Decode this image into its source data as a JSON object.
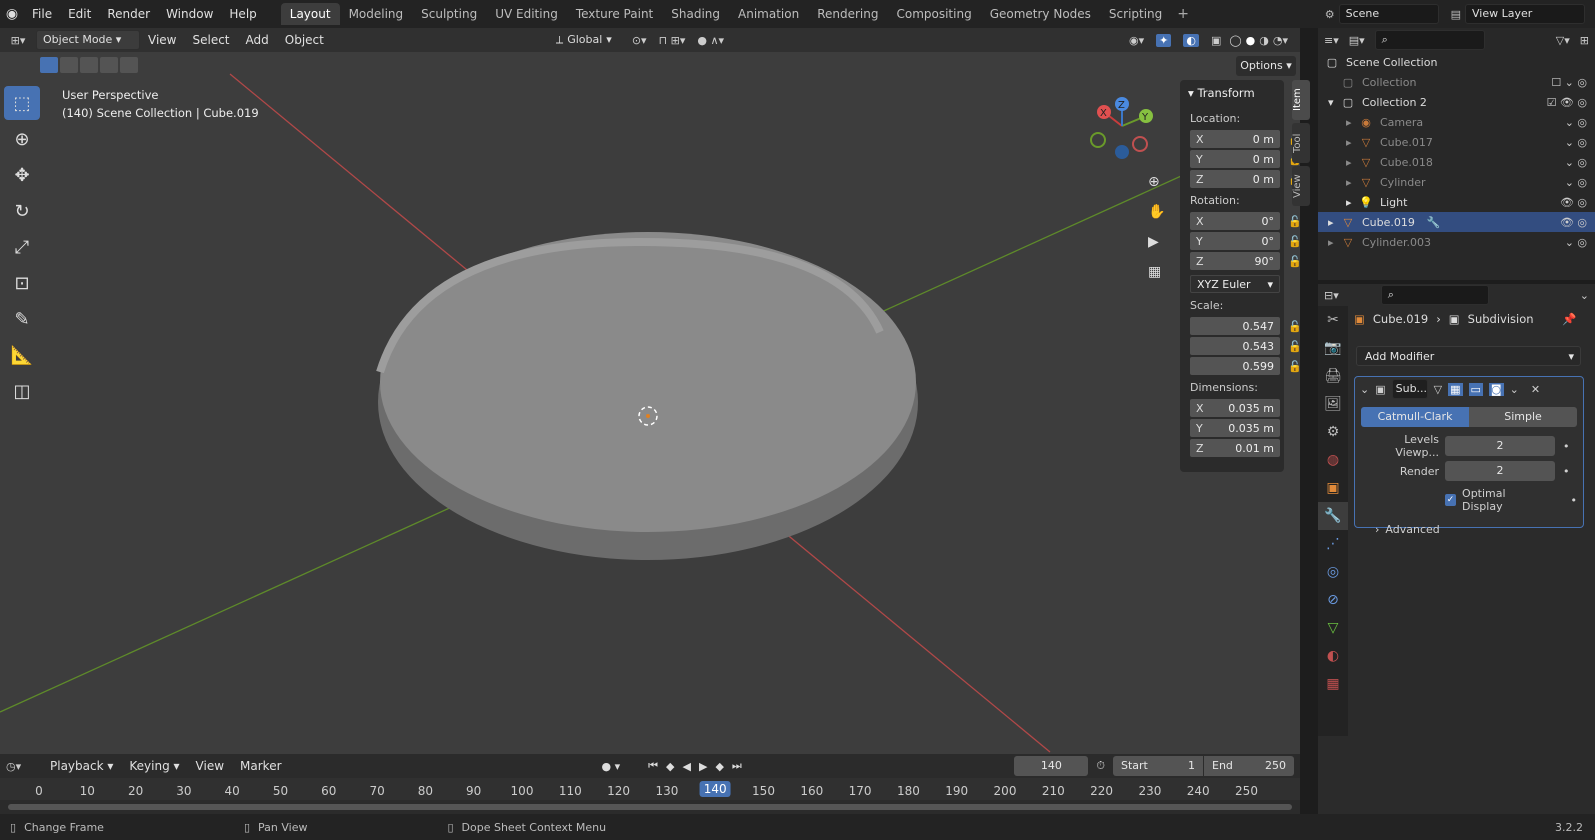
{
  "topbar": {
    "menus": [
      "File",
      "Edit",
      "Render",
      "Window",
      "Help"
    ],
    "workspaces": [
      "Layout",
      "Modeling",
      "Sculpting",
      "UV Editing",
      "Texture Paint",
      "Shading",
      "Animation",
      "Rendering",
      "Compositing",
      "Geometry Nodes",
      "Scripting"
    ],
    "active_workspace": "Layout",
    "scene": "Scene",
    "view_layer": "View Layer"
  },
  "viewport_header": {
    "mode": "Object Mode",
    "menus": [
      "View",
      "Select",
      "Add",
      "Object"
    ],
    "orientation": "Global",
    "options_label": "Options"
  },
  "viewport": {
    "perspective_label": "User Perspective",
    "context_label": "(140) Scene Collection | Cube.019"
  },
  "gizmo": {
    "x": "X",
    "y": "Y",
    "z": "Z"
  },
  "npanel": {
    "tabs": [
      "Item",
      "Tool",
      "View"
    ],
    "section": "Transform",
    "location_label": "Location:",
    "location": [
      {
        "axis": "X",
        "value": "0 m"
      },
      {
        "axis": "Y",
        "value": "0 m"
      },
      {
        "axis": "Z",
        "value": "0 m"
      }
    ],
    "rotation_label": "Rotation:",
    "rotation": [
      {
        "axis": "X",
        "value": "0°"
      },
      {
        "axis": "Y",
        "value": "0°"
      },
      {
        "axis": "Z",
        "value": "90°"
      }
    ],
    "rotation_mode": "XYZ Euler",
    "scale_label": "Scale:",
    "scale": [
      "0.547",
      "0.543",
      "0.599"
    ],
    "dimensions_label": "Dimensions:",
    "dimensions": [
      {
        "axis": "X",
        "value": "0.035 m"
      },
      {
        "axis": "Y",
        "value": "0.035 m"
      },
      {
        "axis": "Z",
        "value": "0.01 m"
      }
    ]
  },
  "outliner": {
    "root": "Scene Collection",
    "items": [
      {
        "name": "Collection",
        "dim": true
      },
      {
        "name": "Collection 2",
        "dim": false
      },
      {
        "name": "Camera",
        "dim": true
      },
      {
        "name": "Cube.017",
        "dim": true
      },
      {
        "name": "Cube.018",
        "dim": true
      },
      {
        "name": "Cylinder",
        "dim": true
      },
      {
        "name": "Light",
        "dim": false
      },
      {
        "name": "Cube.019",
        "dim": false
      },
      {
        "name": "Cylinder.003",
        "dim": true
      }
    ]
  },
  "properties": {
    "object_name": "Cube.019",
    "modifier_path": "Subdivision",
    "add_modifier": "Add Modifier",
    "modifier_short": "Sub...",
    "catmull_clark": "Catmull-Clark",
    "simple": "Simple",
    "levels_viewport_label": "Levels Viewp...",
    "levels_viewport": "2",
    "render_label": "Render",
    "render": "2",
    "optimal_display": "Optimal Display",
    "advanced": "Advanced"
  },
  "timeline": {
    "menus": [
      "Playback",
      "Keying",
      "View",
      "Marker"
    ],
    "current_frame": "140",
    "start_label": "Start",
    "start": "1",
    "end_label": "End",
    "end": "250",
    "ruler": [
      "0",
      "10",
      "20",
      "30",
      "40",
      "50",
      "60",
      "70",
      "80",
      "90",
      "100",
      "110",
      "120",
      "130",
      "140",
      "150",
      "160",
      "170",
      "180",
      "190",
      "200",
      "210",
      "220",
      "230",
      "240",
      "250"
    ]
  },
  "statusbar": {
    "change_frame": "Change Frame",
    "pan_view": "Pan View",
    "context_menu": "Dope Sheet Context Menu",
    "version": "3.2.2"
  },
  "colors": {
    "accent": "#4772b3",
    "x_axis": "#c83c3c",
    "y_axis": "#6a9a2a",
    "z_axis": "#3c78c8"
  }
}
